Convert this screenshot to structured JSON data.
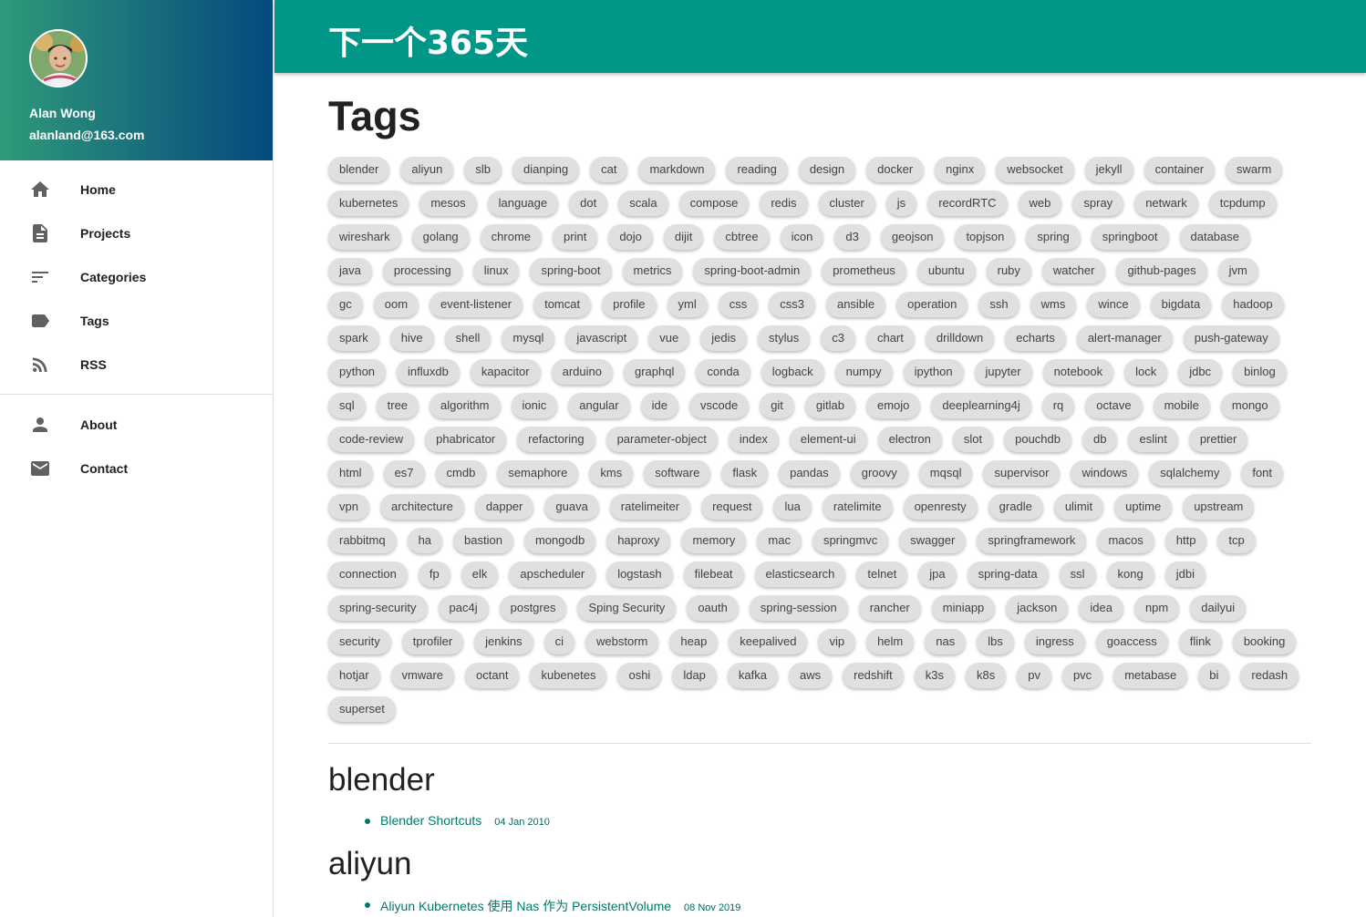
{
  "site": {
    "title": "下一个365天"
  },
  "user": {
    "name": "Alan Wong",
    "email": "alanland@163.com"
  },
  "nav": {
    "primary": [
      {
        "label": "Home",
        "icon": "home-icon"
      },
      {
        "label": "Projects",
        "icon": "document-icon"
      },
      {
        "label": "Categories",
        "icon": "sort-icon"
      },
      {
        "label": "Tags",
        "icon": "tag-icon"
      },
      {
        "label": "RSS",
        "icon": "rss-icon"
      }
    ],
    "secondary": [
      {
        "label": "About",
        "icon": "person-icon"
      },
      {
        "label": "Contact",
        "icon": "mail-icon"
      }
    ]
  },
  "page": {
    "heading": "Tags"
  },
  "tags": [
    "blender",
    "aliyun",
    "slb",
    "dianping",
    "cat",
    "markdown",
    "reading",
    "design",
    "docker",
    "nginx",
    "websocket",
    "jekyll",
    "container",
    "swarm",
    "kubernetes",
    "mesos",
    "language",
    "dot",
    "scala",
    "compose",
    "redis",
    "cluster",
    "js",
    "recordRTC",
    "web",
    "spray",
    "netwark",
    "tcpdump",
    "wireshark",
    "golang",
    "chrome",
    "print",
    "dojo",
    "dijit",
    "cbtree",
    "icon",
    "d3",
    "geojson",
    "topjson",
    "spring",
    "springboot",
    "database",
    "java",
    "processing",
    "linux",
    "spring-boot",
    "metrics",
    "spring-boot-admin",
    "prometheus",
    "ubuntu",
    "ruby",
    "watcher",
    "github-pages",
    "jvm",
    "gc",
    "oom",
    "event-listener",
    "tomcat",
    "profile",
    "yml",
    "css",
    "css3",
    "ansible",
    "operation",
    "ssh",
    "wms",
    "wince",
    "bigdata",
    "hadoop",
    "spark",
    "hive",
    "shell",
    "mysql",
    "javascript",
    "vue",
    "jedis",
    "stylus",
    "c3",
    "chart",
    "drilldown",
    "echarts",
    "alert-manager",
    "push-gateway",
    "python",
    "influxdb",
    "kapacitor",
    "arduino",
    "graphql",
    "conda",
    "logback",
    "numpy",
    "ipython",
    "jupyter",
    "notebook",
    "lock",
    "jdbc",
    "binlog",
    "sql",
    "tree",
    "algorithm",
    "ionic",
    "angular",
    "ide",
    "vscode",
    "git",
    "gitlab",
    "emojo",
    "deeplearning4j",
    "rq",
    "octave",
    "mobile",
    "mongo",
    "code-review",
    "phabricator",
    "refactoring",
    "parameter-object",
    "index",
    "element-ui",
    "electron",
    "slot",
    "pouchdb",
    "db",
    "eslint",
    "prettier",
    "html",
    "es7",
    "cmdb",
    "semaphore",
    "kms",
    "software",
    "flask",
    "pandas",
    "groovy",
    "mqsql",
    "supervisor",
    "windows",
    "sqlalchemy",
    "font",
    "vpn",
    "architecture",
    "dapper",
    "guava",
    "ratelimeiter",
    "request",
    "lua",
    "ratelimite",
    "openresty",
    "gradle",
    "ulimit",
    "uptime",
    "upstream",
    "rabbitmq",
    "ha",
    "bastion",
    "mongodb",
    "haproxy",
    "memory",
    "mac",
    "springmvc",
    "swagger",
    "springframework",
    "macos",
    "http",
    "tcp",
    "connection",
    "fp",
    "elk",
    "apscheduler",
    "logstash",
    "filebeat",
    "elasticsearch",
    "telnet",
    "jpa",
    "spring-data",
    "ssl",
    "kong",
    "jdbi",
    "spring-security",
    "pac4j",
    "postgres",
    "Sping Security",
    "oauth",
    "spring-session",
    "rancher",
    "miniapp",
    "jackson",
    "idea",
    "npm",
    "dailyui",
    "security",
    "tprofiler",
    "jenkins",
    "ci",
    "webstorm",
    "heap",
    "keepalived",
    "vip",
    "helm",
    "nas",
    "lbs",
    "ingress",
    "goaccess",
    "flink",
    "booking",
    "hotjar",
    "vmware",
    "octant",
    "kubenetes",
    "oshi",
    "ldap",
    "kafka",
    "aws",
    "redshift",
    "k3s",
    "k8s",
    "pv",
    "pvc",
    "metabase",
    "bi",
    "redash",
    "superset"
  ],
  "sections": [
    {
      "name": "blender",
      "posts": [
        {
          "title": "Blender Shortcuts",
          "date": "04 Jan 2010"
        }
      ]
    },
    {
      "name": "aliyun",
      "posts": [
        {
          "title": "Aliyun Kubernetes 使用 Nas 作为 PersistentVolume",
          "date": "08 Nov 2019"
        }
      ]
    }
  ],
  "colors": {
    "primary": "#009688",
    "link": "#00796b",
    "chip": "#e0e0e0",
    "header_gradient_start": "#2e9a7a",
    "header_gradient_end": "#034a7e"
  }
}
